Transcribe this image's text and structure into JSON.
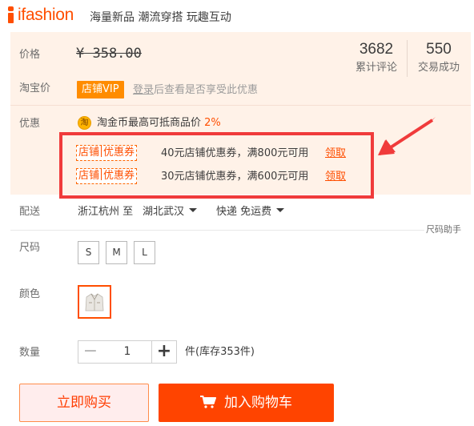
{
  "header": {
    "logo_text": "ifashion",
    "slogan": "海量新品 潮流穿搭 玩趣互动"
  },
  "price": {
    "label": "价格",
    "old_price": "¥ 358.00",
    "reviews_count": "3682",
    "reviews_label": "累计评论",
    "deals_count": "550",
    "deals_label": "交易成功"
  },
  "taobao_price": {
    "label": "淘宝价",
    "vip_badge": "店铺VIP",
    "tip_link": "登录",
    "tip_rest": "后查看是否享受此优惠"
  },
  "promo": {
    "label": "优惠",
    "coin_icon": "淘",
    "coin_text": "淘金币最高可抵商品价",
    "coin_pct": "2%",
    "coupons": [
      {
        "tag_left": "店铺",
        "tag_right": "优惠券",
        "desc": "40元店铺优惠券，满800元可用",
        "action": "领取"
      },
      {
        "tag_left": "店铺",
        "tag_right": "优惠券",
        "desc": "30元店铺优惠券，满600元可用",
        "action": "领取"
      }
    ]
  },
  "delivery": {
    "label": "配送",
    "from": "浙江杭州 至",
    "to": "湖北武汉",
    "shipping": "快递 免运费"
  },
  "size": {
    "label": "尺码",
    "help": "尺码助手",
    "options": [
      "S",
      "M",
      "L"
    ]
  },
  "color": {
    "label": "颜色"
  },
  "quantity": {
    "label": "数量",
    "minus": "−",
    "value": "1",
    "plus": "+",
    "stock": "件(库存353件)"
  },
  "actions": {
    "buy_now": "立即购买",
    "add_to_cart": "加入购物车"
  },
  "colors": {
    "accent": "#ff4400",
    "panel_bg": "#fff2e8",
    "highlight_box": "#f03b3b",
    "vip_badge": "#ff8c00"
  }
}
